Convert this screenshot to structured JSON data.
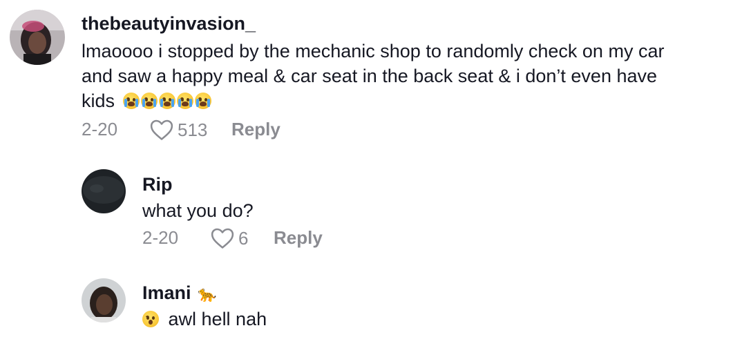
{
  "comments": [
    {
      "username": "thebeautyinvasion_",
      "text_line1": "lmaoooo i stopped by the mechanic shop to randomly check on my car",
      "text_line2": "and saw a happy meal & car seat in the back seat & i don’t even have",
      "text_line3": "kids",
      "emoji_icon": "loudly-crying-face-emoji x5",
      "date": "2-20",
      "likes": "513",
      "reply_label": "Reply"
    },
    {
      "username": "Rip",
      "text": "what you do?",
      "date": "2-20",
      "likes": "6",
      "reply_label": "Reply"
    },
    {
      "username": "Imani",
      "username_emoji": "🐆",
      "text_emoji_icon": "hushed-face-emoji",
      "text": "awl hell nah"
    }
  ],
  "colors": {
    "text": "#161823",
    "muted": "#8a8b91"
  }
}
